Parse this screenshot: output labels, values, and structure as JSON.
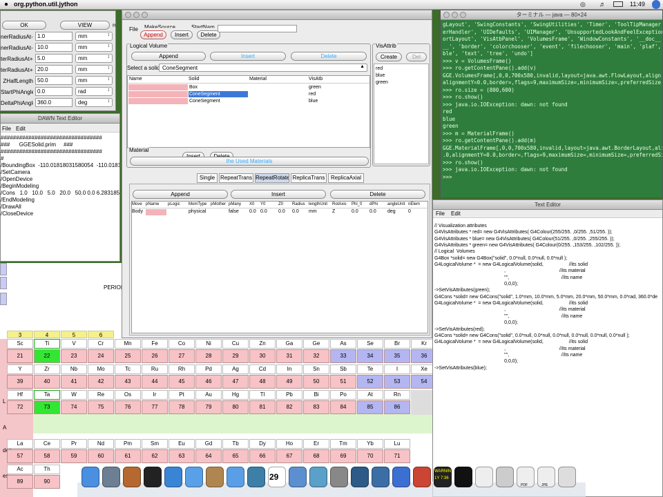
{
  "menubar": {
    "app": "org.python.util.jython",
    "clock": "11:49"
  },
  "param_window": {
    "ok": "OK",
    "view": "VIEW",
    "edge": "ro",
    "rows": [
      {
        "label": "nerRadiusAt-dz",
        "value": "1.0",
        "unit": "mm"
      },
      {
        "label": "nerRadiusAt-dz",
        "value": "10.0",
        "unit": "mm"
      },
      {
        "label": "terRadiusAt+dz",
        "value": "5.0",
        "unit": "mm"
      },
      {
        "label": "terRadiusAt+dz",
        "value": "20.0",
        "unit": "mm"
      },
      {
        "label": "ZHalfLength",
        "value": "50.0",
        "unit": "mm"
      },
      {
        "label": "StartPhiAngle",
        "value": "0.0",
        "unit": "rad"
      },
      {
        "label": "DeltaPhiAngle",
        "value": "360.0",
        "unit": "deg"
      }
    ]
  },
  "dawn_editor": {
    "title": "DAWN Text Editor",
    "menu": [
      "File",
      "Edit"
    ],
    "lines": [
      "#################################",
      "###      GGESolid.prim     ###",
      "#################################",
      "#",
      "/BoundingBox  -110.01818031580054  -110.018180",
      "/SetCamera",
      "/OpenDevice",
      "/BeginModeling",
      "",
      "/Cons   1.0   10.0   5.0   20.0   50.0 0.0 6.28318530",
      "",
      "/EndModeling",
      "/DrawAll",
      "/CloseDevice"
    ]
  },
  "main_window": {
    "menu": [
      "File",
      "MakeSource",
      "StartNam"
    ],
    "top_buttons": [
      "Append",
      "Insert",
      "Delete"
    ],
    "logical_volume": {
      "title": "Logical Volume",
      "buttons": [
        "Append",
        "Insert",
        "Delete"
      ],
      "select_label": "Select a solid",
      "select_value": "ConeSegment",
      "headers": [
        "Name",
        "Solid",
        "Material",
        "VisAtb"
      ],
      "rows": [
        {
          "solid": "Box",
          "vis": "green"
        },
        {
          "solid": "ConeSegment",
          "vis": "red"
        },
        {
          "solid": "ConeSegment",
          "vis": "blue"
        }
      ]
    },
    "vis_attrib": {
      "title": "VisAttrib",
      "create": "Create",
      "del": "Del",
      "items": [
        "red",
        "blue",
        "green"
      ]
    },
    "materials": {
      "title": "Material",
      "insert": "Insert",
      "delete": "Delete",
      "used": "the Used Materials"
    },
    "placement_tabs": [
      "Single",
      "RepeatTrans",
      "RepeatRotate",
      "ReplicaTrans",
      "ReplicaAxial"
    ],
    "placement_buttons": [
      "Append",
      "Insert",
      "Delete"
    ],
    "placement_headers": [
      "Move",
      "pName",
      "pLogic",
      "MomType",
      "pMother",
      "pMany",
      "X0",
      "Y0",
      "Z0",
      "Radius",
      "lengthUnit",
      "RotAxis",
      "Phi_0",
      "dPhi",
      "angleUnit",
      "nElem"
    ],
    "placement_row": [
      "Body",
      "",
      "",
      "physical",
      "",
      "false",
      "0.0",
      "0.0",
      "0.0",
      "0.0",
      "mm",
      "Z",
      "0.0",
      "0.0",
      "deg",
      "0"
    ]
  },
  "terminal": {
    "title": "ターミナル — java — 80×24",
    "lines": [
      "gLayout', 'SwingConstants', 'SwingUtilities', 'Timer', 'ToolTipManager",
      "erHandler', 'UIDefaults', 'UIManager', 'UnsupportedLookAndFeelException",
      "ortLayout', 'VisAtbPanel', 'VolumesFrame', 'WindowConstants', '__doc__",
      "__', 'border', 'colorchooser', 'event', 'filechooser', 'main', 'plaf',",
      "ble', 'text', 'tree', 'undo']",
      ">>> v = VolumesFrame()",
      ">>> ro.getContentPane().add(v)",
      "GGE.VolumesFrame[,0,0,700x580,invalid,layout=java.awt.FlowLayout,align",
      "alignmentY=0.0,border=,flags=9,maximumSize=,minimumSize=,preferredSize",
      ">>> ro.size = (800,600)",
      ">>> ro.show()",
      ">>> java.io.IOException: dawn: not found",
      "red",
      "blue",
      "green",
      "",
      ">>> m = MaterialFrame()",
      ">>> ro.getContentPane().add(m)",
      "GGE.MaterialFrame[,0,0,700x580,invalid,layout=java.awt.BorderLayout,ali",
      ".0,alignmentY=0.0,border=,flags=9,maximumSize=,minimumSize=,preferredSi",
      ">>> ro.show()",
      ">>> java.io.IOException: dawn: not found",
      "",
      ">>> "
    ]
  },
  "text_editor": {
    "title": "Text Editor",
    "menu": [
      "File",
      "Edit"
    ],
    "lines": [
      "// Visualization attributes",
      "",
      "",
      "G4VisAttributes * red= new G4VisAttributes( G4Colour(255/255. ,0/255. ,51/255. ));",
      "",
      "G4VisAttributes * blue= new G4VisAttributes( G4Colour(51/255. ,0/255. ,255/255. ));",
      "",
      "G4VisAttributes * green= new G4VisAttributes( G4Colour(0/255. ,153/255. ,102/255. ));",
      "",
      "// Logical  Volumes",
      "",
      "G4Box *solid= new G4Box(\"solid\", 0.0*null, 0.0*null, 0.0*null );",
      "G4LogicalVolume *  = new G4LogicalVolume(solid,                   //its solid",
      "                                                    ,                                        //its material",
      "                                                    \"\",                                       //its name",
      "                                                    0,0,0);",
      "",
      "->SetVisAttributes(green);",
      "",
      "G4Cons *solid= new G4Cons(\"solid\", 1.0*mm, 10.0*mm, 5.0*mm, 20.0*mm, 50.0*mm, 0.0*rad, 360.0*de",
      "G4LogicalVolume *  = new G4LogicalVolume(solid,                   //its solid",
      "                                                    ,                                        //its material",
      "                                                    \"\",                                       //its name",
      "                                                    0,0,0);",
      "",
      "->SetVisAttributes(red);",
      "",
      "G4Cons *solid= new G4Cons(\"solid\", 0.0*null, 0.0*null, 0.0*null, 0.0*null, 0.0*null, 0.0*null );",
      "G4LogicalVolume *  = new G4LogicalVolume(solid,                   //its solid",
      "                                                    ,                                        //its material",
      "                                                    \"\",                                       //its name",
      "                                                    0,0,0);",
      "",
      "->SetVisAttributes(blue);"
    ]
  },
  "periodic": {
    "label": "PERIOD",
    "group_numbers": [
      "3",
      "4",
      "5",
      "6"
    ],
    "row_labels": [
      "",
      "",
      "L",
      "A",
      "des",
      "es"
    ],
    "rows": [
      [
        [
          "Sc",
          "21"
        ],
        [
          "Ti",
          "22"
        ],
        [
          "V",
          "23"
        ],
        [
          "Cr",
          "24"
        ],
        [
          "Mn",
          "25"
        ],
        [
          "Fe",
          "26"
        ],
        [
          "Co",
          "27"
        ],
        [
          "Ni",
          "28"
        ],
        [
          "Cu",
          "29"
        ],
        [
          "Zn",
          "30"
        ],
        [
          "Ga",
          "31"
        ],
        [
          "Ge",
          "32"
        ],
        [
          "As",
          "33"
        ],
        [
          "Se",
          "34"
        ],
        [
          "Br",
          "35"
        ],
        [
          "Kr",
          "36"
        ]
      ],
      [
        [
          "Y",
          "39"
        ],
        [
          "Zr",
          "40"
        ],
        [
          "Nb",
          "41"
        ],
        [
          "Mo",
          "42"
        ],
        [
          "Tc",
          "43"
        ],
        [
          "Ru",
          "44"
        ],
        [
          "Rh",
          "45"
        ],
        [
          "Pd",
          "46"
        ],
        [
          "Ag",
          "47"
        ],
        [
          "Cd",
          "48"
        ],
        [
          "In",
          "49"
        ],
        [
          "Sn",
          "50"
        ],
        [
          "Sb",
          "51"
        ],
        [
          "Te",
          "52"
        ],
        [
          "I",
          "53"
        ],
        [
          "Xe",
          "54"
        ]
      ],
      [
        [
          "Hf",
          "72"
        ],
        [
          "Ta",
          "73"
        ],
        [
          "W",
          "74"
        ],
        [
          "Re",
          "75"
        ],
        [
          "Os",
          "76"
        ],
        [
          "Ir",
          "77"
        ],
        [
          "Pt",
          "78"
        ],
        [
          "Au",
          "79"
        ],
        [
          "Hg",
          "80"
        ],
        [
          "Tl",
          "81"
        ],
        [
          "Pb",
          "82"
        ],
        [
          "Bi",
          "83"
        ],
        [
          "Po",
          "84"
        ],
        [
          "At",
          "85"
        ],
        [
          "Rn",
          "86"
        ]
      ],
      [
        [
          "La",
          "57"
        ],
        [
          "Ce",
          "58"
        ],
        [
          "Pr",
          "59"
        ],
        [
          "Nd",
          "60"
        ],
        [
          "Pm",
          "61"
        ],
        [
          "Sm",
          "62"
        ],
        [
          "Eu",
          "63"
        ],
        [
          "Gd",
          "64"
        ],
        [
          "Tb",
          "65"
        ],
        [
          "Dy",
          "66"
        ],
        [
          "Ho",
          "67"
        ],
        [
          "Er",
          "68"
        ],
        [
          "Tm",
          "69"
        ],
        [
          "Yb",
          "70"
        ],
        [
          "Lu",
          "71"
        ]
      ],
      [
        [
          "Ac",
          "89"
        ],
        [
          "Th",
          "90"
        ]
      ]
    ]
  },
  "dock": {
    "calendar_day": "29",
    "warn_label": "WARNIN",
    "warn_time": "1Y 7:36",
    "pdf_label": "PDF",
    "jpg_label": "JPE"
  },
  "colors": {
    "terminal_bg": "#2f7d3c",
    "cell_pink": "#f7c3c7",
    "cell_blue": "#b3b6f0",
    "cell_green": "#33e633",
    "group_yellow": "#f5f08a"
  }
}
